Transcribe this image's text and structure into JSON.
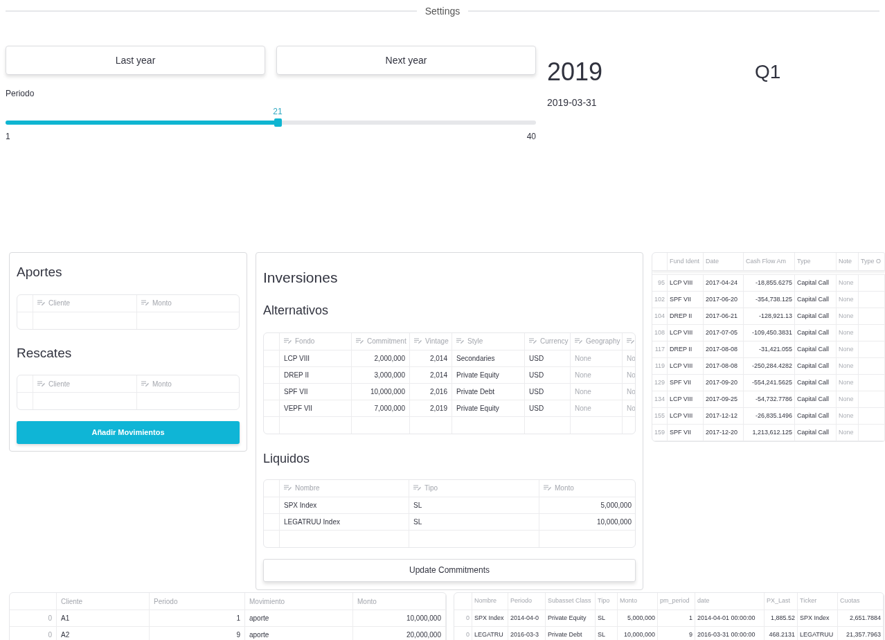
{
  "settings_header": {
    "title": "Settings"
  },
  "year_buttons": [
    {
      "label": "Last year"
    },
    {
      "label": "Next year"
    }
  ],
  "year": "2019",
  "quarter": "Q1",
  "date": "2019-03-31",
  "slider": {
    "label": "Periodo",
    "value": "21",
    "min": "1",
    "max": "40",
    "level": 0.513
  },
  "aportes": {
    "title": "Aportes",
    "table": {
      "editable": true,
      "columns": [
        {
          "label": "Cliente"
        },
        {
          "label": "Monto"
        }
      ]
    }
  },
  "rescates": {
    "title": "Rescates",
    "table": {
      "editable": true,
      "columns": [
        {
          "label": "Cliente"
        },
        {
          "label": "Monto"
        }
      ]
    }
  },
  "add_button": {
    "label": "Añadir Movimientos"
  },
  "inversiones": {
    "title": "Inversiones",
    "alternativos": {
      "title": "Alternativos",
      "table": {
        "editable": true,
        "columns": [
          {
            "label": "Fondo",
            "kind": "text"
          },
          {
            "label": "Commitment",
            "kind": "number"
          },
          {
            "label": "Vintage",
            "kind": "number"
          },
          {
            "label": "Style",
            "kind": "text"
          },
          {
            "label": "Currency",
            "kind": "text"
          },
          {
            "label": "Geography",
            "kind": "null"
          },
          {
            "kind": "null"
          }
        ],
        "rows": [
          [
            "LCP VIII",
            "2,000,000",
            "2,014",
            "Secondaries",
            "USD",
            "None",
            "No"
          ],
          [
            "DREP II",
            "3,000,000",
            "2,014",
            "Private Equity",
            "USD",
            "None",
            "No"
          ],
          [
            "SPF VII",
            "10,000,000",
            "2,016",
            "Private Debt",
            "USD",
            "None",
            "No"
          ],
          [
            "VEPF VII",
            "7,000,000",
            "2,019",
            "Private Equity",
            "USD",
            "None",
            "No"
          ]
        ]
      }
    },
    "liquidos": {
      "title": "Liquidos",
      "table": {
        "editable": true,
        "columns": [
          {
            "label": "Nombre",
            "kind": "text"
          },
          {
            "label": "Tipo",
            "kind": "text"
          },
          {
            "label": "Monto",
            "kind": "number"
          }
        ],
        "rows": [
          [
            "SPX Index",
            "SL",
            "5,000,000"
          ],
          [
            "LEGATRUU Index",
            "SL",
            "10,000,000"
          ]
        ]
      }
    },
    "update_button": {
      "label": "Update Commitments"
    }
  },
  "cash_flows": {
    "table": {
      "editable": false,
      "columns": [
        {
          "kind": "index"
        },
        {
          "label": "Fund Ident",
          "kind": "text"
        },
        {
          "label": "Date",
          "kind": "text"
        },
        {
          "label": "Cash Flow Am",
          "kind": "number"
        },
        {
          "label": "Type",
          "kind": "text"
        },
        {
          "label": "Note",
          "kind": "null"
        },
        {
          "label": "Type O",
          "kind": "text"
        }
      ],
      "rows": [
        [
          "95",
          "LCP VIII",
          "2017-04-24",
          "-18,855.6275",
          "Capital Call",
          "None"
        ],
        [
          "102",
          "SPF VII",
          "2017-06-20",
          "-354,738.125",
          "Capital Call",
          "None"
        ],
        [
          "104",
          "DREP II",
          "2017-06-21",
          "-128,921.13",
          "Capital Call",
          "None"
        ],
        [
          "108",
          "LCP VIII",
          "2017-07-05",
          "-109,450.3831",
          "Capital Call",
          "None"
        ],
        [
          "117",
          "DREP II",
          "2017-08-08",
          "-31,421.055",
          "Capital Call",
          "None"
        ],
        [
          "119",
          "LCP VIII",
          "2017-08-08",
          "-250,284.4282",
          "Capital Call",
          "None"
        ],
        [
          "129",
          "SPF VII",
          "2017-09-20",
          "-554,241.5625",
          "Capital Call",
          "None"
        ],
        [
          "134",
          "LCP VIII",
          "2017-09-25",
          "-54,732.7786",
          "Capital Call",
          "None"
        ],
        [
          "155",
          "LCP VIII",
          "2017-12-12",
          "-26,835.1496",
          "Capital Call",
          "None"
        ],
        [
          "159",
          "SPF VII",
          "2017-12-20",
          "1,213,612.125",
          "Capital Call",
          "None"
        ]
      ]
    }
  },
  "movements": {
    "table": {
      "editable": false,
      "columns": [
        {
          "kind": "index"
        },
        {
          "label": "Cliente",
          "kind": "text"
        },
        {
          "label": "Periodo",
          "kind": "number"
        },
        {
          "label": "Movimiento",
          "kind": "text"
        },
        {
          "label": "Monto",
          "kind": "number"
        }
      ],
      "rows": [
        [
          "0",
          "A1",
          "1",
          "aporte",
          "10,000,000"
        ],
        [
          "0",
          "A2",
          "9",
          "aporte",
          "20,000,000"
        ]
      ]
    }
  },
  "positions": {
    "table": {
      "editable": false,
      "columns": [
        {
          "kind": "index"
        },
        {
          "label": "Nombre",
          "kind": "text"
        },
        {
          "label": "Periodo",
          "kind": "text"
        },
        {
          "label": "Subasset Class",
          "kind": "text"
        },
        {
          "label": "Tipo",
          "kind": "text"
        },
        {
          "label": "Monto",
          "kind": "number"
        },
        {
          "label": "pm_period",
          "kind": "number"
        },
        {
          "label": "date",
          "kind": "text"
        },
        {
          "label": "PX_Last",
          "kind": "number"
        },
        {
          "label": "Ticker",
          "kind": "text"
        },
        {
          "label": "Cuotas",
          "kind": "number"
        }
      ],
      "rows": [
        [
          "0",
          "SPX Index",
          "2014-04-0",
          "Private Equity",
          "SL",
          "5,000,000",
          "1",
          "2014-04-01 00:00:00",
          "1,885.52",
          "SPX Index",
          "2,651.7884"
        ],
        [
          "0",
          "LEGATRU",
          "2016-03-3",
          "Private Debt",
          "SL",
          "10,000,000",
          "9",
          "2016-03-31 00:00:00",
          "468.2131",
          "LEGATRUU",
          "21,357.7963"
        ]
      ]
    }
  }
}
